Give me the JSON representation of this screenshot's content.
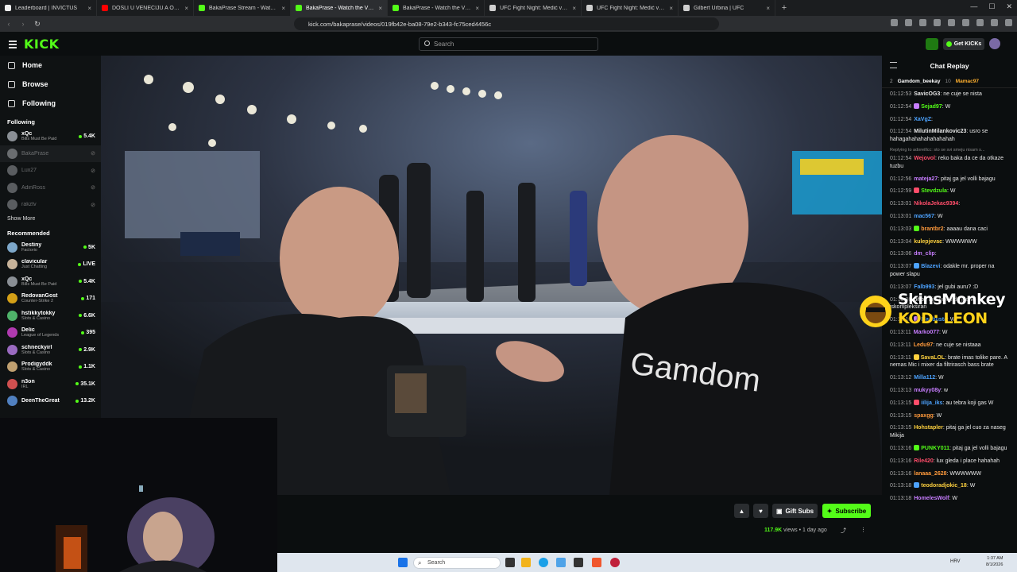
{
  "browser": {
    "tabs": [
      {
        "label": "Leaderboard | INVICTUS",
        "color": "#f0f0f0",
        "active": false
      },
      {
        "label": "DOSLI U VENECIJU A ONDA...*ODLETELI*",
        "color": "#ff0000",
        "active": false
      },
      {
        "label": "BakaPrase Stream - Watch Live on Kick",
        "color": "#53fc18",
        "active": false
      },
      {
        "label": "BakaPrase - Watch the VOD on Kick",
        "color": "#53fc18",
        "active": true
      },
      {
        "label": "BakaPrase - Watch the VOD on Kick",
        "color": "#53fc18",
        "active": false
      },
      {
        "label": "UFC Fight Night: Medić vs. Rodriguez",
        "color": "#cfcfcf",
        "active": false
      },
      {
        "label": "UFC Fight Night: Medić vs. Rodriguez",
        "color": "#cfcfcf",
        "active": false
      },
      {
        "label": "Gilbert Urbina | UFC",
        "color": "#cfcfcf",
        "active": false
      }
    ],
    "url": "kick.com/bakaprase/videos/019fb42e-ba08-79e2-b343-fc75ced4456c"
  },
  "header": {
    "logo": "KICK",
    "search_placeholder": "Search",
    "get_kicks": "Get KICKs"
  },
  "sidebar": {
    "nav": [
      {
        "label": "Home",
        "icon": "home-icon"
      },
      {
        "label": "Browse",
        "icon": "browse-icon"
      },
      {
        "label": "Following",
        "icon": "heart-icon"
      }
    ],
    "following_title": "Following",
    "following": [
      {
        "name": "xQc",
        "category": "Bills Must Be Paid",
        "viewers": "5.4K",
        "online": true,
        "color": "#8a8f95"
      },
      {
        "name": "BakaPrase",
        "category": "",
        "viewers": "",
        "online": false,
        "selected": true,
        "color": "#6a6d70"
      },
      {
        "name": "Lux27",
        "category": "",
        "viewers": "",
        "online": false,
        "color": "#5a5d60"
      },
      {
        "name": "AdinRoss",
        "category": "",
        "viewers": "",
        "online": false,
        "color": "#5a5d60"
      },
      {
        "name": "rakztv",
        "category": "",
        "viewers": "",
        "online": false,
        "color": "#5a5d60"
      }
    ],
    "show_more": "Show More",
    "recommended_title": "Recommended",
    "recommended": [
      {
        "name": "Destiny",
        "category": "Factorio",
        "viewers": "5K",
        "color": "#7da7c9"
      },
      {
        "name": "clavicular",
        "category": "Just Chatting",
        "viewers": "LIVE",
        "color": "#c7b39a"
      },
      {
        "name": "xQc",
        "category": "Bills Must Be Paid",
        "viewers": "5.4K",
        "color": "#8a8f95"
      },
      {
        "name": "RedovanGost",
        "category": "Counter-Strike 2",
        "viewers": "171",
        "color": "#d4a017"
      },
      {
        "name": "hstikkytokky",
        "category": "Slots & Casino",
        "viewers": "6.6K",
        "color": "#4fb36a"
      },
      {
        "name": "Delic",
        "category": "League of Legends",
        "viewers": "395",
        "color": "#b03ab0"
      },
      {
        "name": "schneckyirl",
        "category": "Slots & Casino",
        "viewers": "2.9K",
        "color": "#9a6ac0"
      },
      {
        "name": "Prodigyddk",
        "category": "Slots & Casino",
        "viewers": "1.1K",
        "color": "#c0a070"
      },
      {
        "name": "n3on",
        "category": "IRL",
        "viewers": "35.1K",
        "color": "#d05050"
      },
      {
        "name": "DeenTheGreat",
        "category": "",
        "viewers": "13.2K",
        "color": "#5080c0"
      }
    ]
  },
  "vod": {
    "views": "117.9K",
    "views_label": "views",
    "age": "1 day ago",
    "gift_subs": "Gift Subs",
    "subscribe": "Subscribe"
  },
  "chat": {
    "title": "Chat Replay",
    "pinned": [
      {
        "rank": "2",
        "name": "Gamdom_beekay",
        "count": "10"
      },
      {
        "rank": "",
        "name": "Mamac97",
        "count": ""
      }
    ],
    "messages": [
      {
        "time": "01:12:53",
        "user": "SavicOG3",
        "color": "#e8e8e8",
        "text": "ne cuje se nista"
      },
      {
        "time": "01:12:54",
        "user": "Sejad97",
        "color": "#53fc18",
        "text": "W"
      },
      {
        "time": "01:12:54",
        "user": "XaVgZ",
        "color": "#4da3ff",
        "text": ""
      },
      {
        "time": "01:12:54",
        "user": "MilutinMilankovic23",
        "color": "#e8e8e8",
        "text": "usro se hahagahahahahahahahah"
      },
      {
        "reply": "Replying to adoreillcc: sto se svi smeju nisam s..."
      },
      {
        "time": "01:12:54",
        "user": "Wejovol",
        "color": "#ff4d6a",
        "text": "reko baka da ce da otkaze tuzbu"
      },
      {
        "time": "01:12:56",
        "user": "mateja27",
        "color": "#c77dff",
        "text": "pitaj ga jel volli bajagu"
      },
      {
        "time": "01:12:59",
        "user": "Stevdzula",
        "color": "#53fc18",
        "text": "W"
      },
      {
        "time": "01:13:01",
        "user": "NikolaJekac9394",
        "color": "#ff4d6a",
        "text": ""
      },
      {
        "time": "01:13:01",
        "user": "mac567",
        "color": "#4da3ff",
        "text": "W"
      },
      {
        "time": "01:13:03",
        "user": "brantbr2",
        "color": "#ff9a3c",
        "text": "aaaau dana caci"
      },
      {
        "time": "01:13:04",
        "user": "kulepjevac",
        "color": "#ffd23f",
        "text": "WWWWWW"
      },
      {
        "time": "01:13:06",
        "user": "dm_clip",
        "color": "#c77dff",
        "text": ""
      },
      {
        "time": "01:13:07",
        "user": "Blazevi",
        "color": "#4da3ff",
        "text": "odakle mr. proper na power slapu"
      },
      {
        "time": "01:13:07",
        "user": "Falb993",
        "color": "#4da3ff",
        "text": "jel gubi auru? :D"
      },
      {
        "time": "01:13:08",
        "user": "bhbl",
        "color": "#e8e8e8",
        "text": "nije sekunde jedne iskompleksiran"
      },
      {
        "time": "01:13:10",
        "user": "Madbusta",
        "color": "#4da3ff",
        "text": "W"
      },
      {
        "time": "01:13:11",
        "user": "Marko077",
        "color": "#c77dff",
        "text": "W"
      },
      {
        "time": "01:13:11",
        "user": "Ledu97",
        "color": "#ff9a3c",
        "text": "ne cuje se nistaaa"
      },
      {
        "time": "01:13:11",
        "user": "SavaLOL",
        "color": "#ffd23f",
        "text": "brate imas tolike pare. A nemas Mic i mixer da filtrirasch bass brate"
      },
      {
        "time": "01:13:12",
        "user": "Milla112",
        "color": "#4da3ff",
        "text": "W"
      },
      {
        "time": "01:13:13",
        "user": "mukyy08y",
        "color": "#c77dff",
        "text": "w"
      },
      {
        "time": "01:13:15",
        "user": "iilija_iks",
        "color": "#4da3ff",
        "text": "au tebra koji gas W"
      },
      {
        "time": "01:13:15",
        "user": "spaxgg",
        "color": "#ff9a3c",
        "text": "W"
      },
      {
        "time": "01:13:15",
        "user": "Hohstapler",
        "color": "#ffd23f",
        "text": "pitaj ga jel cuo za naseg Mikija"
      },
      {
        "time": "01:13:16",
        "user": "PUNKY011",
        "color": "#53fc18",
        "text": "pitaj ga jel volli bajagu"
      },
      {
        "time": "01:13:16",
        "user": "Rile420",
        "color": "#ff4d6a",
        "text": "lux gleda i place hahahah"
      },
      {
        "time": "01:13:16",
        "user": "lanaaa_2628",
        "color": "#ff9a3c",
        "text": "WWWWWW"
      },
      {
        "time": "01:13:18",
        "user": "teodoradjokic_18",
        "color": "#ffd23f",
        "text": "W"
      },
      {
        "time": "01:13:18",
        "user": "HomelesWolf",
        "color": "#c77dff",
        "text": "W"
      }
    ]
  },
  "overlay": {
    "brand": "SkinsMonkey",
    "code": "KOD: LEON"
  },
  "taskbar": {
    "search": "Search",
    "lang": "HRV",
    "time": "1:37 AM",
    "date": "8/1/2026"
  }
}
